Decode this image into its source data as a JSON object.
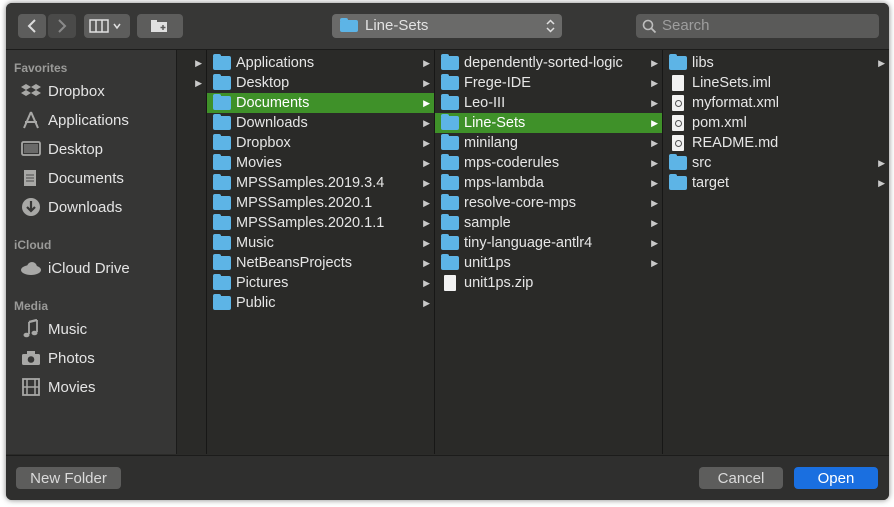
{
  "toolbar": {
    "back_icon": "chevron-left-icon",
    "forward_icon": "chevron-right-icon",
    "view_icon": "column-view-icon",
    "new_folder_icon": "new-folder-icon",
    "path_label": "Line-Sets",
    "search_placeholder": "Search"
  },
  "sidebar": {
    "favorites_heading": "Favorites",
    "favorites": [
      {
        "label": "Dropbox",
        "icon": "dropbox-icon"
      },
      {
        "label": "Applications",
        "icon": "applications-icon"
      },
      {
        "label": "Desktop",
        "icon": "desktop-icon"
      },
      {
        "label": "Documents",
        "icon": "documents-icon"
      },
      {
        "label": "Downloads",
        "icon": "downloads-icon"
      }
    ],
    "icloud_heading": "iCloud",
    "icloud": [
      {
        "label": "iCloud Drive",
        "icon": "cloud-icon"
      }
    ],
    "media_heading": "Media",
    "media": [
      {
        "label": "Music",
        "icon": "music-icon"
      },
      {
        "label": "Photos",
        "icon": "camera-icon"
      },
      {
        "label": "Movies",
        "icon": "film-icon"
      }
    ]
  },
  "columns": [
    {
      "items": [
        {
          "label": "",
          "has_children": true
        },
        {
          "label": "",
          "has_children": true
        }
      ]
    },
    {
      "items": [
        {
          "label": "Applications",
          "type": "folder",
          "has_children": true
        },
        {
          "label": "Desktop",
          "type": "folder",
          "has_children": true
        },
        {
          "label": "Documents",
          "type": "folder",
          "has_children": true,
          "selected": true
        },
        {
          "label": "Downloads",
          "type": "folder",
          "has_children": true
        },
        {
          "label": "Dropbox",
          "type": "folder",
          "has_children": true
        },
        {
          "label": "Movies",
          "type": "folder",
          "has_children": true
        },
        {
          "label": "MPSSamples.2019.3.4",
          "type": "folder",
          "has_children": true
        },
        {
          "label": "MPSSamples.2020.1",
          "type": "folder",
          "has_children": true
        },
        {
          "label": "MPSSamples.2020.1.1",
          "type": "folder",
          "has_children": true
        },
        {
          "label": "Music",
          "type": "folder",
          "has_children": true
        },
        {
          "label": "NetBeansProjects",
          "type": "folder",
          "has_children": true
        },
        {
          "label": "Pictures",
          "type": "folder",
          "has_children": true
        },
        {
          "label": "Public",
          "type": "folder",
          "has_children": true
        }
      ]
    },
    {
      "items": [
        {
          "label": "dependently-sorted-logic",
          "type": "folder",
          "has_children": true
        },
        {
          "label": "Frege-IDE",
          "type": "folder",
          "has_children": true
        },
        {
          "label": "Leo-III",
          "type": "folder",
          "has_children": true
        },
        {
          "label": "Line-Sets",
          "type": "folder",
          "has_children": true,
          "selected": true
        },
        {
          "label": "minilang",
          "type": "folder",
          "has_children": true
        },
        {
          "label": "mps-coderules",
          "type": "folder",
          "has_children": true
        },
        {
          "label": "mps-lambda",
          "type": "folder",
          "has_children": true
        },
        {
          "label": "resolve-core-mps",
          "type": "folder",
          "has_children": true
        },
        {
          "label": "sample",
          "type": "folder",
          "has_children": true
        },
        {
          "label": "tiny-language-antlr4",
          "type": "folder",
          "has_children": true
        },
        {
          "label": "unit1ps",
          "type": "folder",
          "has_children": true
        },
        {
          "label": "unit1ps.zip",
          "type": "file",
          "has_children": false
        }
      ]
    },
    {
      "items": [
        {
          "label": "libs",
          "type": "folder",
          "has_children": true
        },
        {
          "label": "LineSets.iml",
          "type": "file",
          "has_children": false
        },
        {
          "label": "myformat.xml",
          "type": "xml",
          "has_children": false
        },
        {
          "label": "pom.xml",
          "type": "xml",
          "has_children": false
        },
        {
          "label": "README.md",
          "type": "xml",
          "has_children": false
        },
        {
          "label": "src",
          "type": "folder",
          "has_children": true
        },
        {
          "label": "target",
          "type": "folder",
          "has_children": true
        }
      ]
    }
  ],
  "bottom": {
    "new_folder_label": "New Folder",
    "cancel_label": "Cancel",
    "open_label": "Open"
  },
  "colors": {
    "selection": "#3f9129",
    "folder": "#5db4e6",
    "primary_button": "#1a6fe0"
  }
}
